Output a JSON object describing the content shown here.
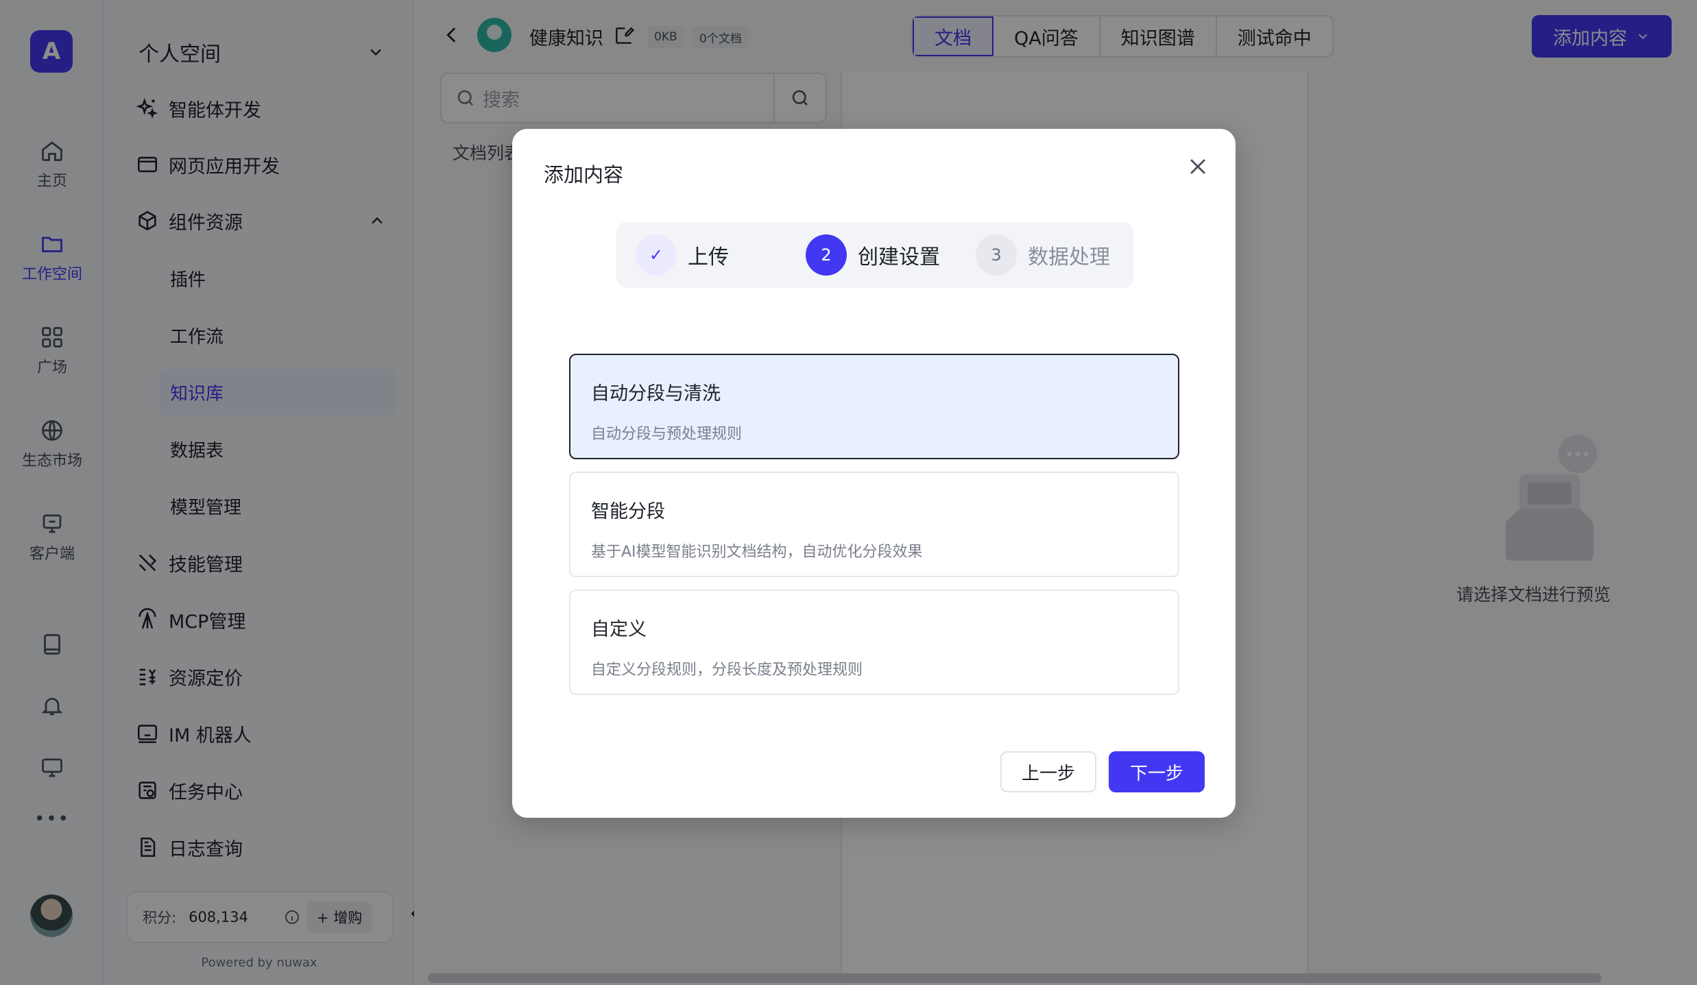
{
  "rail": {
    "logo_text": "A",
    "items": [
      {
        "label": "主页"
      },
      {
        "label": "工作空间"
      },
      {
        "label": "广场"
      },
      {
        "label": "生态市场"
      },
      {
        "label": "客户端"
      }
    ],
    "active_index": 1,
    "more_label": "•••"
  },
  "nav": {
    "space_title": "个人空间",
    "items": [
      {
        "label": "智能体开发"
      },
      {
        "label": "网页应用开发"
      },
      {
        "label": "组件资源"
      }
    ],
    "sub_items": [
      {
        "label": "插件"
      },
      {
        "label": "工作流"
      },
      {
        "label": "知识库"
      },
      {
        "label": "数据表"
      },
      {
        "label": "模型管理"
      }
    ],
    "active_sub_index": 2,
    "more_items": [
      {
        "label": "技能管理"
      },
      {
        "label": "MCP管理"
      },
      {
        "label": "资源定价"
      },
      {
        "label": "IM 机器人"
      },
      {
        "label": "任务中心"
      },
      {
        "label": "日志查询"
      }
    ],
    "credits_label": "积分:",
    "credits_value": "608,134",
    "buy_label": "+ 增购",
    "powered_by": "Powered by nuwax"
  },
  "header": {
    "kb_title": "健康知识",
    "size_tag": "0KB",
    "count_tag": "0个文档",
    "tabs": [
      {
        "label": "文档"
      },
      {
        "label": "QA问答"
      },
      {
        "label": "知识图谱"
      },
      {
        "label": "测试命中"
      }
    ],
    "active_tab": 0,
    "add_label": "添加内容"
  },
  "search": {
    "placeholder": "搜索"
  },
  "doc_list_label": "文档列表",
  "preview_empty_text": "请选择文档进行预览",
  "modal": {
    "title": "添加内容",
    "steps": [
      {
        "num": "✓",
        "label": "上传",
        "state": "done"
      },
      {
        "num": "2",
        "label": "创建设置",
        "state": "current"
      },
      {
        "num": "3",
        "label": "数据处理",
        "state": "todo"
      }
    ],
    "options": [
      {
        "title": "自动分段与清洗",
        "desc": "自动分段与预处理规则",
        "selected": true
      },
      {
        "title": "智能分段",
        "desc": "基于AI模型智能识别文档结构，自动优化分段效果",
        "selected": false
      },
      {
        "title": "自定义",
        "desc": "自定义分段规则，分段长度及预处理规则",
        "selected": false
      }
    ],
    "prev_label": "上一步",
    "next_label": "下一步"
  },
  "colors": {
    "accent": "#4338f2",
    "selected_bg": "#e8efff"
  }
}
